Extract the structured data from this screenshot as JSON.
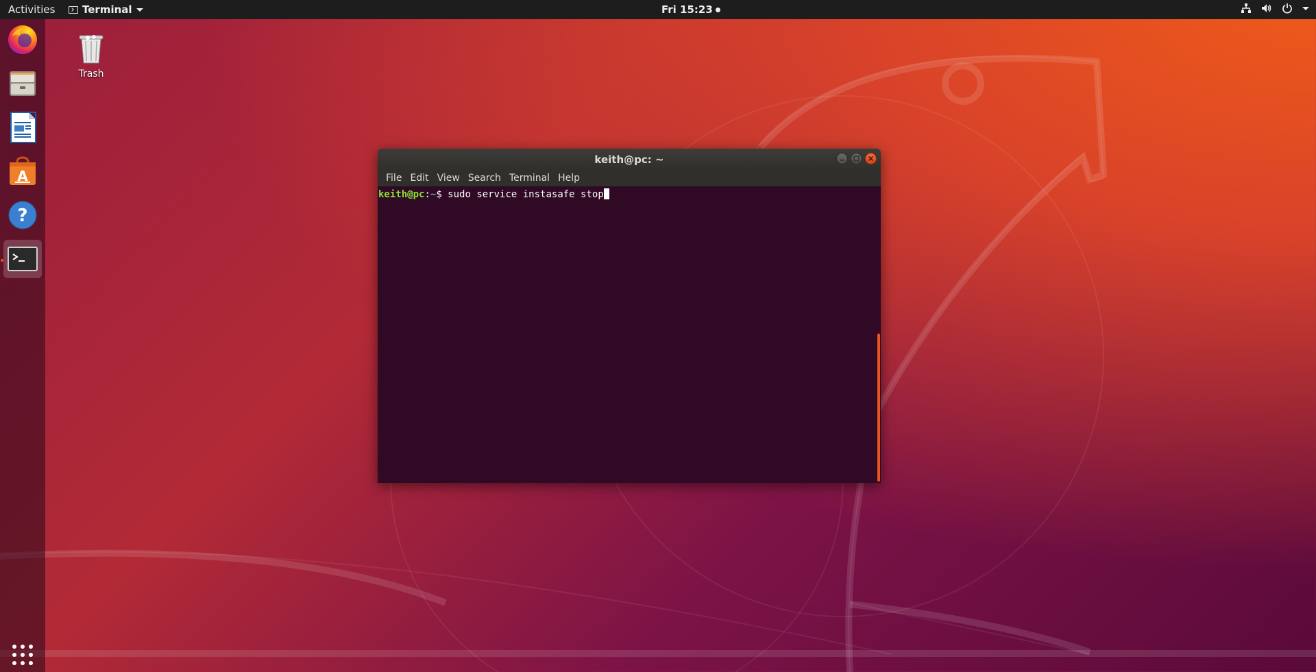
{
  "topbar": {
    "activities": "Activities",
    "app_name": "Terminal",
    "clock": "Fri 15:23"
  },
  "dock": {
    "items": [
      {
        "name": "firefox",
        "icon": "firefox-icon"
      },
      {
        "name": "files",
        "icon": "files-icon"
      },
      {
        "name": "libreoffice-writer",
        "icon": "writer-icon"
      },
      {
        "name": "software",
        "icon": "software-icon"
      },
      {
        "name": "help",
        "icon": "help-icon"
      },
      {
        "name": "terminal",
        "icon": "terminal-icon",
        "active": true
      }
    ],
    "show_apps_icon": "grid-icon"
  },
  "desktop": {
    "trash_label": "Trash"
  },
  "window": {
    "title": "keith@pc: ~",
    "menu": [
      "File",
      "Edit",
      "View",
      "Search",
      "Terminal",
      "Help"
    ],
    "prompt_user": "keith@pc",
    "prompt_sep": ":",
    "prompt_path": "~",
    "prompt_symbol": "$ ",
    "command": "sudo service instasafe stop"
  },
  "colors": {
    "accent": "#e95420",
    "terminal_bg": "#300a24",
    "prompt_user": "#8ae234",
    "prompt_path": "#729fcf"
  }
}
